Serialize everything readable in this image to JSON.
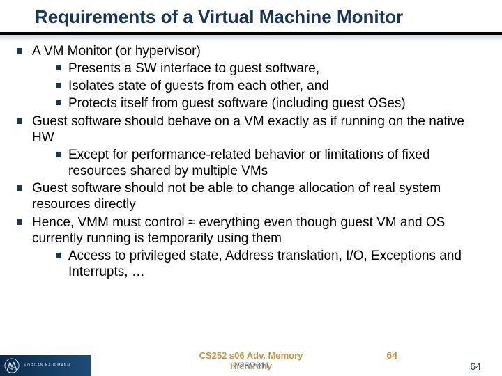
{
  "title": "Requirements of a Virtual Machine Monitor",
  "bullets": [
    {
      "text": "A VM Monitor (or hypervisor)",
      "children": [
        "Presents a SW interface to guest software,",
        "Isolates state of guests from each other, and",
        "Protects itself from guest software (including guest OSes)"
      ]
    },
    {
      "text": "Guest software should behave on a VM exactly as if running on the native HW",
      "children": [
        "Except for performance-related behavior or limitations of fixed resources shared by multiple VMs"
      ]
    },
    {
      "text": "Guest software should not be able to change allocation of real system resources directly",
      "children": []
    },
    {
      "text": "Hence, VMM must control ≈ everything even though guest VM and OS currently running is temporarily using them",
      "children": [
        "Access to privileged state, Address translation, I/O, Exceptions and Interrupts, …"
      ]
    }
  ],
  "footer": {
    "center_line1": "CS252 s06 Adv. Memory",
    "center_line2": "Hierarchy",
    "date_overlay": "2/28/2011",
    "page_gold": "64",
    "page_dark": "64",
    "logo_text": "MORGAN KAUFMANN"
  }
}
